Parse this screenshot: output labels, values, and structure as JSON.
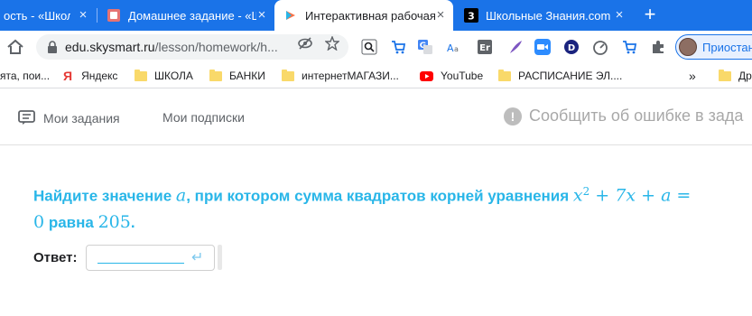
{
  "browser": {
    "tabs": [
      {
        "title": "ость - «Школьн",
        "active": false
      },
      {
        "title": "Домашнее задание - «Ш",
        "active": false
      },
      {
        "title": "Интерактивная рабочая",
        "active": true
      },
      {
        "title": "Школьные Знания.com",
        "active": false
      }
    ],
    "newtab_label": "+",
    "address": {
      "host": "edu.skysmart.ru",
      "path": "/lesson/homework/h..."
    },
    "profile_label": "Приостан",
    "bookmarks": [
      {
        "label": "ята, пои...",
        "icon": "none"
      },
      {
        "label": "Яндекс",
        "icon": "yandex-icon"
      },
      {
        "label": "ШКОЛА",
        "icon": "folder-icon"
      },
      {
        "label": "БАНКИ",
        "icon": "folder-icon"
      },
      {
        "label": "интернетМАГАЗИ...",
        "icon": "folder-icon"
      },
      {
        "label": "YouTube",
        "icon": "youtube-icon"
      },
      {
        "label": "РАСПИСАНИЕ ЭЛ....",
        "icon": "folder-icon"
      },
      {
        "label": "»",
        "icon": "none"
      },
      {
        "label": "Др",
        "icon": "folder-icon"
      }
    ]
  },
  "page": {
    "nav": {
      "my_tasks": "Мои задания",
      "my_subscriptions": "Мои подписки",
      "report_error": "Сообщить об ошибке в зада"
    },
    "task": {
      "t1": "Найдите значение ",
      "var_a": "a",
      "t2": ", при котором сумма квадратов корней уравнения ",
      "eq_x": "x",
      "eq_exp": "2",
      "eq_rest": " + 7x + a =",
      "eq_zero": "0",
      "t3": " равна ",
      "num": "205",
      "t4": "."
    },
    "answer_label": "Ответ:"
  },
  "colors": {
    "accent": "#29b6e8",
    "browser_blue": "#1a73e8"
  }
}
